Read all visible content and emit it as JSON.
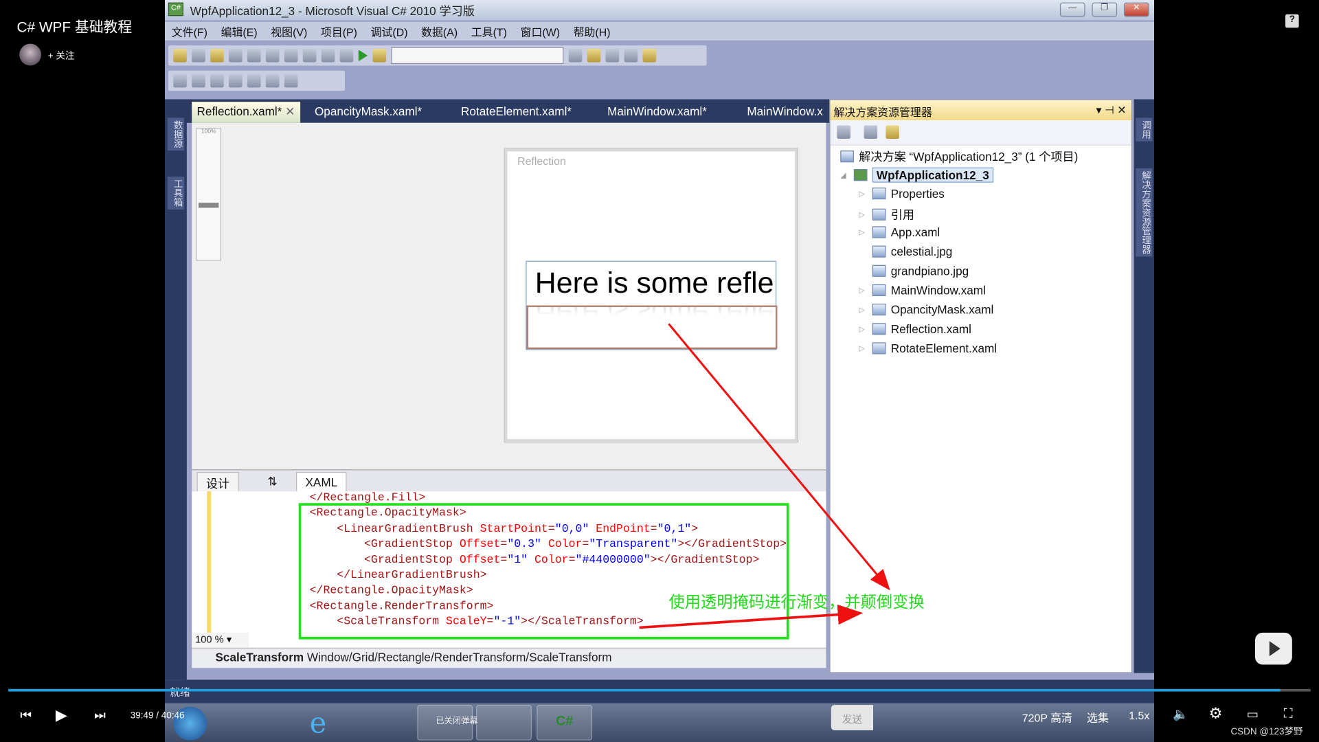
{
  "video": {
    "title": "C# WPF 基础教程",
    "follow": "+ 关注",
    "help_icon": "?",
    "time_current": "39:49",
    "time_sep": "/",
    "time_total": "40:46",
    "progress_fraction": 0.977,
    "send": "发送",
    "quality": "720P 高清",
    "episodes": "选集",
    "speed": "1.5x",
    "watermark": "CSDN @123梦野",
    "danmaku_status": "已关闭弹幕"
  },
  "window": {
    "title": "WpfApplication12_3 - Microsoft Visual C# 2010 学习版",
    "app_icon": "C#"
  },
  "menu": [
    "文件(F)",
    "编辑(E)",
    "视图(V)",
    "项目(P)",
    "调试(D)",
    "数据(A)",
    "工具(T)",
    "窗口(W)",
    "帮助(H)"
  ],
  "tabs": [
    "Reflection.xaml*",
    "OpancityMask.xaml*",
    "RotateElement.xaml*",
    "MainWindow.xaml*",
    "MainWindow.x"
  ],
  "left_strip": [
    "数据源",
    "工具箱"
  ],
  "design": {
    "zoom_label": "100%",
    "window_title": "Reflection",
    "sample_text": "Here is some refle"
  },
  "split_tabs": {
    "design": "设计",
    "swap": "⇅",
    "xaml": "XAML"
  },
  "code": [
    [
      [
        "t",
        "</Rectangle.Fill>"
      ]
    ],
    [
      [
        "t",
        "<Rectangle.OpacityMask>"
      ]
    ],
    [
      [
        "t",
        "    <LinearGradientBrush "
      ],
      [
        "a",
        "StartPoint"
      ],
      [
        "t",
        "="
      ],
      [
        "v",
        "\"0,0\""
      ],
      [
        "a",
        " EndPoint"
      ],
      [
        "t",
        "="
      ],
      [
        "v",
        "\"0,1\""
      ],
      [
        "t",
        ">"
      ]
    ],
    [
      [
        "t",
        "        <GradientStop "
      ],
      [
        "a",
        "Offset"
      ],
      [
        "t",
        "="
      ],
      [
        "v",
        "\"0.3\""
      ],
      [
        "a",
        " Color"
      ],
      [
        "t",
        "="
      ],
      [
        "v",
        "\"Transparent\""
      ],
      [
        "t",
        "></GradientStop>"
      ]
    ],
    [
      [
        "t",
        "        <GradientStop "
      ],
      [
        "a",
        "Offset"
      ],
      [
        "t",
        "="
      ],
      [
        "v",
        "\"1\""
      ],
      [
        "a",
        " Color"
      ],
      [
        "t",
        "="
      ],
      [
        "v",
        "\"#44000000\""
      ],
      [
        "t",
        "></GradientStop>"
      ]
    ],
    [
      [
        "t",
        "    </LinearGradientBrush>"
      ]
    ],
    [
      [
        "t",
        "</Rectangle.OpacityMask>"
      ]
    ],
    [
      [
        "t",
        "<Rectangle.RenderTransform>"
      ]
    ],
    [
      [
        "t",
        "    <ScaleTransform "
      ],
      [
        "a",
        "ScaleY"
      ],
      [
        "t",
        "="
      ],
      [
        "v",
        "\"-1\""
      ],
      [
        "t",
        "></ScaleTransform>"
      ]
    ]
  ],
  "code_zoom": "100 %",
  "pathbar": {
    "element": "ScaleTransform",
    "path": "Window/Grid/Rectangle/RenderTransform/ScaleTransform"
  },
  "solution": {
    "header": "解决方案资源管理器",
    "root": "解决方案 “WpfApplication12_3” (1 个项目)",
    "project": "WpfApplication12_3",
    "items": [
      {
        "label": "Properties",
        "exp": true
      },
      {
        "label": "引用",
        "exp": true
      },
      {
        "label": "App.xaml",
        "exp": true
      },
      {
        "label": "celestial.jpg",
        "exp": false
      },
      {
        "label": "grandpiano.jpg",
        "exp": false
      },
      {
        "label": "MainWindow.xaml",
        "exp": true
      },
      {
        "label": "OpancityMask.xaml",
        "exp": true
      },
      {
        "label": "Reflection.xaml",
        "exp": true
      },
      {
        "label": "RotateElement.xaml",
        "exp": true
      }
    ]
  },
  "right_strip": [
    "调用",
    "解决方案资源管理器"
  ],
  "status": "就绪",
  "annotation": {
    "text": "使用透明掩码进行渐变，并颠倒变换",
    "color": "#22d81a",
    "arrow_color": "#ee1111",
    "box_color": "#22e01a"
  }
}
